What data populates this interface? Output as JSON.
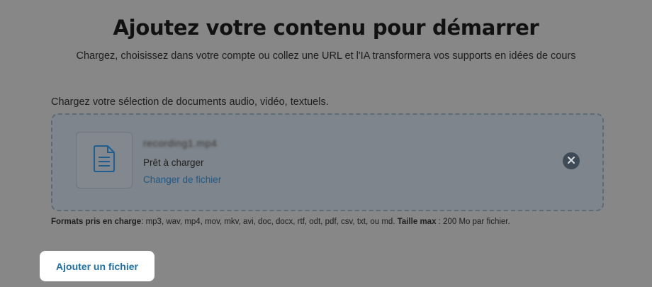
{
  "header": {
    "title": "Ajoutez votre contenu pour démarrer",
    "subtitle": "Chargez, choisissez dans votre compte ou collez une URL et l'IA transformera vos supports en idées de cours"
  },
  "upload": {
    "label": "Chargez votre sélection de documents audio, vidéo, textuels.",
    "file": {
      "name": "recording1.mp4",
      "status": "Prêt à charger",
      "change_label": "Changer de fichier",
      "icon": "document-icon"
    },
    "formats_label": "Formats pris en charge",
    "formats_value": ": mp3, wav, mp4, mov, mkv, avi, doc, docx, rtf, odt, pdf, csv, txt, ou md.",
    "max_label": "Taille max",
    "max_value": " : 200 Mo par fichier."
  },
  "actions": {
    "add_file_label": "Ajouter un fichier"
  },
  "colors": {
    "overlay": "#878787",
    "accent": "#1f6fa8",
    "link": "#1d5a88"
  }
}
